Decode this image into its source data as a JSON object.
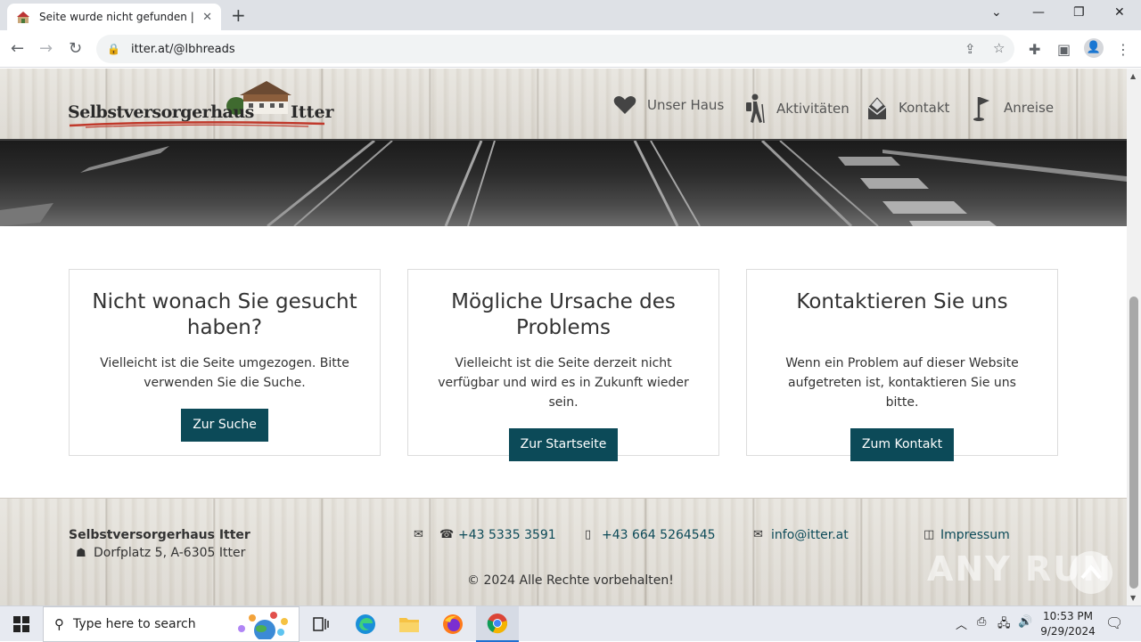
{
  "browser": {
    "tab_title": "Seite wurde nicht gefunden | Selbstversorgerhaus Itter",
    "tab_close": "✕",
    "new_tab": "+",
    "url": "itter.at/@lbhreads",
    "window_controls": {
      "dropdown": "⌄",
      "minimize": "—",
      "restore": "❐",
      "close": "✕"
    }
  },
  "site": {
    "logo": {
      "text": "Selbstversorgerhaus",
      "text2": "Itter"
    },
    "nav": [
      {
        "label": "Unser Haus",
        "icon": "heart-icon"
      },
      {
        "label": "Aktivitäten",
        "icon": "hiker-icon"
      },
      {
        "label": "Kontakt",
        "icon": "mail-icon"
      },
      {
        "label": "Anreise",
        "icon": "flag-icon"
      }
    ],
    "cards": [
      {
        "title": "Nicht wonach Sie gesucht haben?",
        "text": "Vielleicht ist die Seite umgezogen. Bitte verwenden Sie die Suche.",
        "button": "Zur Suche"
      },
      {
        "title": "Mögliche Ursache des Problems",
        "text": "Vielleicht ist die Seite derzeit nicht verfügbar und wird es in Zukunft wieder sein.",
        "button": "Zur Startseite"
      },
      {
        "title": "Kontaktieren Sie uns",
        "text": "Wenn ein Problem auf dieser Website aufgetreten ist, kontaktieren Sie uns bitte.",
        "button": "Zum Kontakt"
      }
    ],
    "footer": {
      "name": "Selbstversorgerhaus Itter",
      "address": "Dorfplatz 5, A-6305 Itter",
      "phone": "+43 5335 3591",
      "mobile": "+43 664 5264545",
      "email": "info@itter.at",
      "impressum": "Impressum",
      "copyright": "© 2024 Alle Rechte vorbehalten!"
    },
    "watermark": "ANY RUN"
  },
  "taskbar": {
    "search_placeholder": "Type here to search",
    "time": "10:53 PM",
    "date": "9/29/2024"
  },
  "colors": {
    "button": "#0c4a58",
    "link": "#0c4a58"
  }
}
